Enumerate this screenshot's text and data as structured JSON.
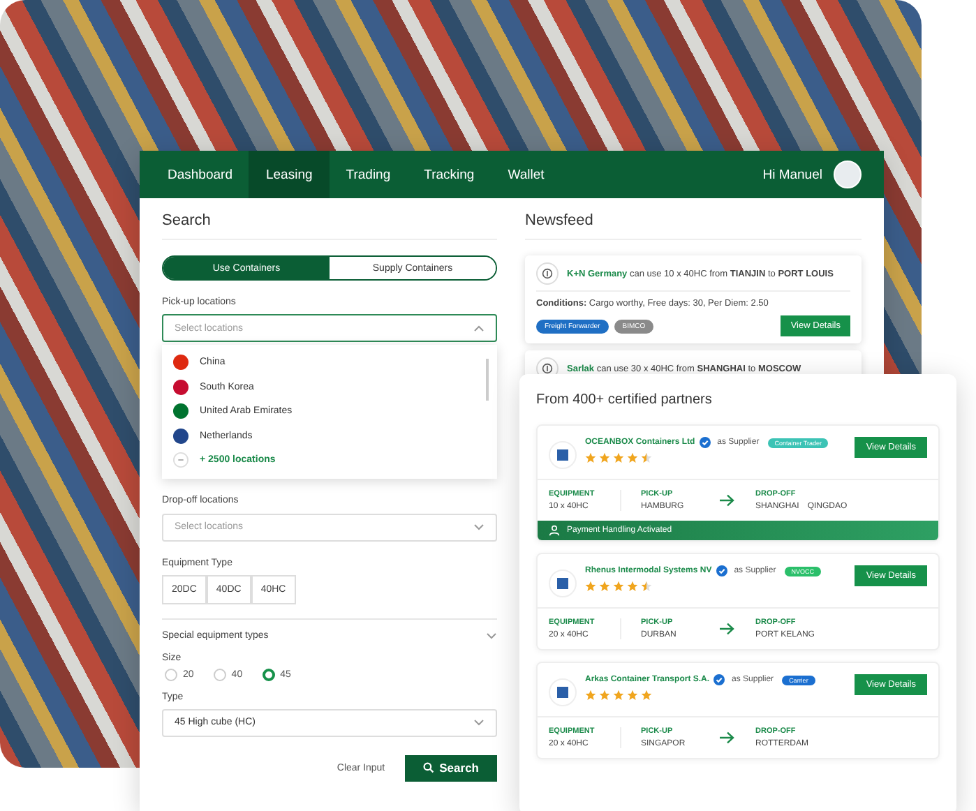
{
  "nav": {
    "tabs": [
      {
        "label": "Dashboard",
        "selected": false
      },
      {
        "label": "Leasing",
        "selected": true
      },
      {
        "label": "Trading",
        "selected": false
      },
      {
        "label": "Tracking",
        "selected": false
      },
      {
        "label": "Wallet",
        "selected": false
      }
    ],
    "greeting": "Hi Manuel"
  },
  "search": {
    "title": "Search",
    "modes": [
      {
        "label": "Use Containers",
        "selected": true
      },
      {
        "label": "Supply Containers",
        "selected": false
      }
    ],
    "pickup": {
      "label": "Pick-up locations",
      "placeholder": "Select locations",
      "expanded": true,
      "options": [
        {
          "kind": "country",
          "color": "#de2910",
          "label": "China"
        },
        {
          "kind": "country",
          "color": "#c60c30",
          "label": "South Korea"
        },
        {
          "kind": "country",
          "color": "#00732f",
          "label": "United Arab Emirates"
        },
        {
          "kind": "country",
          "color": "#21468b",
          "label": "Netherlands"
        },
        {
          "kind": "more",
          "label": "+ 2500 locations"
        }
      ]
    },
    "dropoff": {
      "label": "Drop-off locations",
      "placeholder": "Select locations",
      "expanded": false
    },
    "equipment": {
      "label": "Equipment Type",
      "options": [
        {
          "label": "20DC",
          "selected": false
        },
        {
          "label": "40DC",
          "selected": false
        },
        {
          "label": "40HC",
          "selected": false
        }
      ]
    },
    "special": {
      "label": "Special equipment types",
      "expanded": false
    },
    "size": {
      "label": "Size",
      "options": [
        {
          "label": "20",
          "selected": false
        },
        {
          "label": "40",
          "selected": false
        },
        {
          "label": "45",
          "selected": true
        }
      ]
    },
    "type": {
      "label": "Type",
      "value": "45 High cube (HC)",
      "expanded": false
    },
    "clear": "Clear Input",
    "submit": "Search"
  },
  "newsfeed": {
    "title": "Newsfeed",
    "items": [
      {
        "company": "K+N Germany",
        "message": "can use 10 x 40HC from **TIANJIN** to **PORT LOUIS**",
        "conditions": "**Conditions:** Cargo worthy, Free days: 30, Per Diem: 2.50",
        "tags": [
          {
            "label": "Freight Forwarder",
            "color": "#1f6fc4"
          },
          {
            "label": "BIMCO",
            "color": "#8a8a8a"
          }
        ],
        "button": "View Details"
      },
      {
        "company": "Sarlak",
        "message": "can use 30 x 40HC from **SHANGHAI** to **MOSCOW**"
      }
    ]
  },
  "partners": {
    "title": "From 400+ certified partners",
    "cards": [
      {
        "name": "OCEANBOX Containers Ltd",
        "role": "as Supplier",
        "tag": {
          "label": "Container Trader",
          "color": "#3cc3b5"
        },
        "stars": 4.5,
        "button": "View Details",
        "equipment_label": "EQUIPMENT",
        "equipment": "10 x 40HC",
        "pickup_label": "PICK-UP",
        "pickup": "HAMBURG",
        "dropoff_label": "DROP-OFF",
        "dropoff": [
          "SHANGHAI",
          "QINGDAO"
        ],
        "payment": "Payment Handling Activated"
      },
      {
        "name": "Rhenus Intermodal Systems NV",
        "role": "as Supplier",
        "tag": {
          "label": "NVOCC",
          "color": "#2bbf6a"
        },
        "stars": 4.5,
        "button": "View Details",
        "equipment_label": "EQUIPMENT",
        "equipment": "20 x 40HC",
        "pickup_label": "PICK-UP",
        "pickup": "DURBAN",
        "dropoff_label": "DROP-OFF",
        "dropoff": [
          "PORT KELANG"
        ]
      },
      {
        "name": "Arkas Container Transport S.A.",
        "role": "as Supplier",
        "tag": {
          "label": "Carrier",
          "color": "#1b6fd0"
        },
        "stars": 5,
        "button": "View Details",
        "equipment_label": "EQUIPMENT",
        "equipment": "20 x 40HC",
        "pickup_label": "PICK-UP",
        "pickup": "SINGAPOR",
        "dropoff_label": "DROP-OFF",
        "dropoff": [
          "ROTTERDAM"
        ]
      }
    ]
  }
}
